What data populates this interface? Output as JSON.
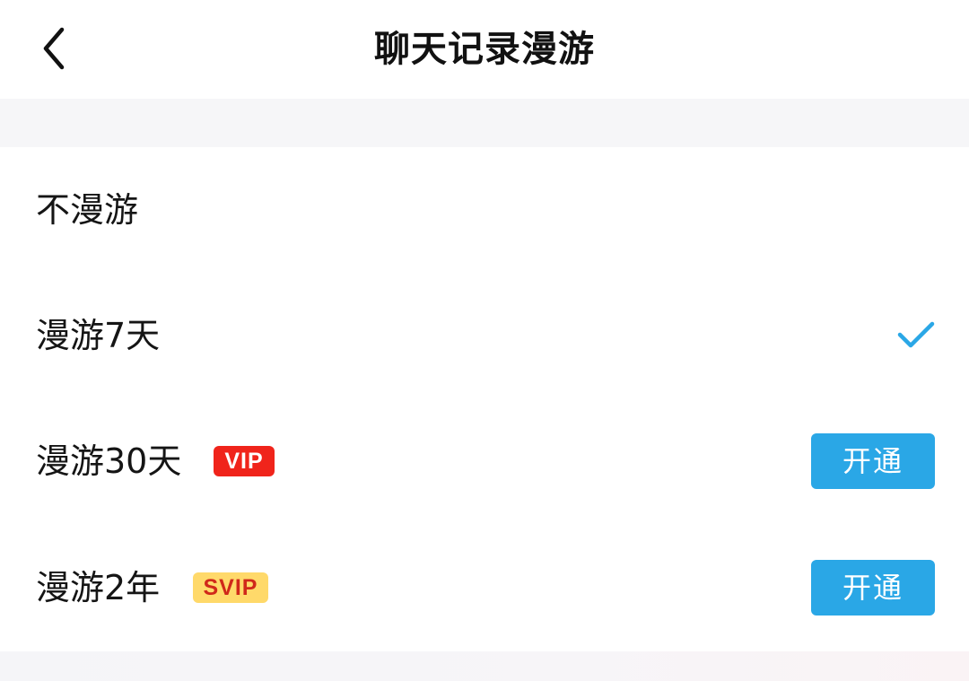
{
  "header": {
    "title": "聊天记录漫游",
    "back_icon": "chevron-left-icon"
  },
  "options": [
    {
      "label": "不漫游",
      "selected": false
    },
    {
      "label": "漫游7天",
      "selected": true,
      "check_icon": "checkmark-icon"
    },
    {
      "label": "漫游30天",
      "badge": "VIP",
      "button_label": "开通",
      "selected": false
    },
    {
      "label": "漫游2年",
      "badge": "SVIP",
      "button_label": "开通",
      "selected": false
    }
  ],
  "colors": {
    "accent": "#2aa7e6",
    "vip_badge_bg": "#f0241b",
    "svip_badge_bg": "#ffd96a",
    "svip_badge_text": "#d0281a",
    "section_gap": "#f6f6f8"
  }
}
